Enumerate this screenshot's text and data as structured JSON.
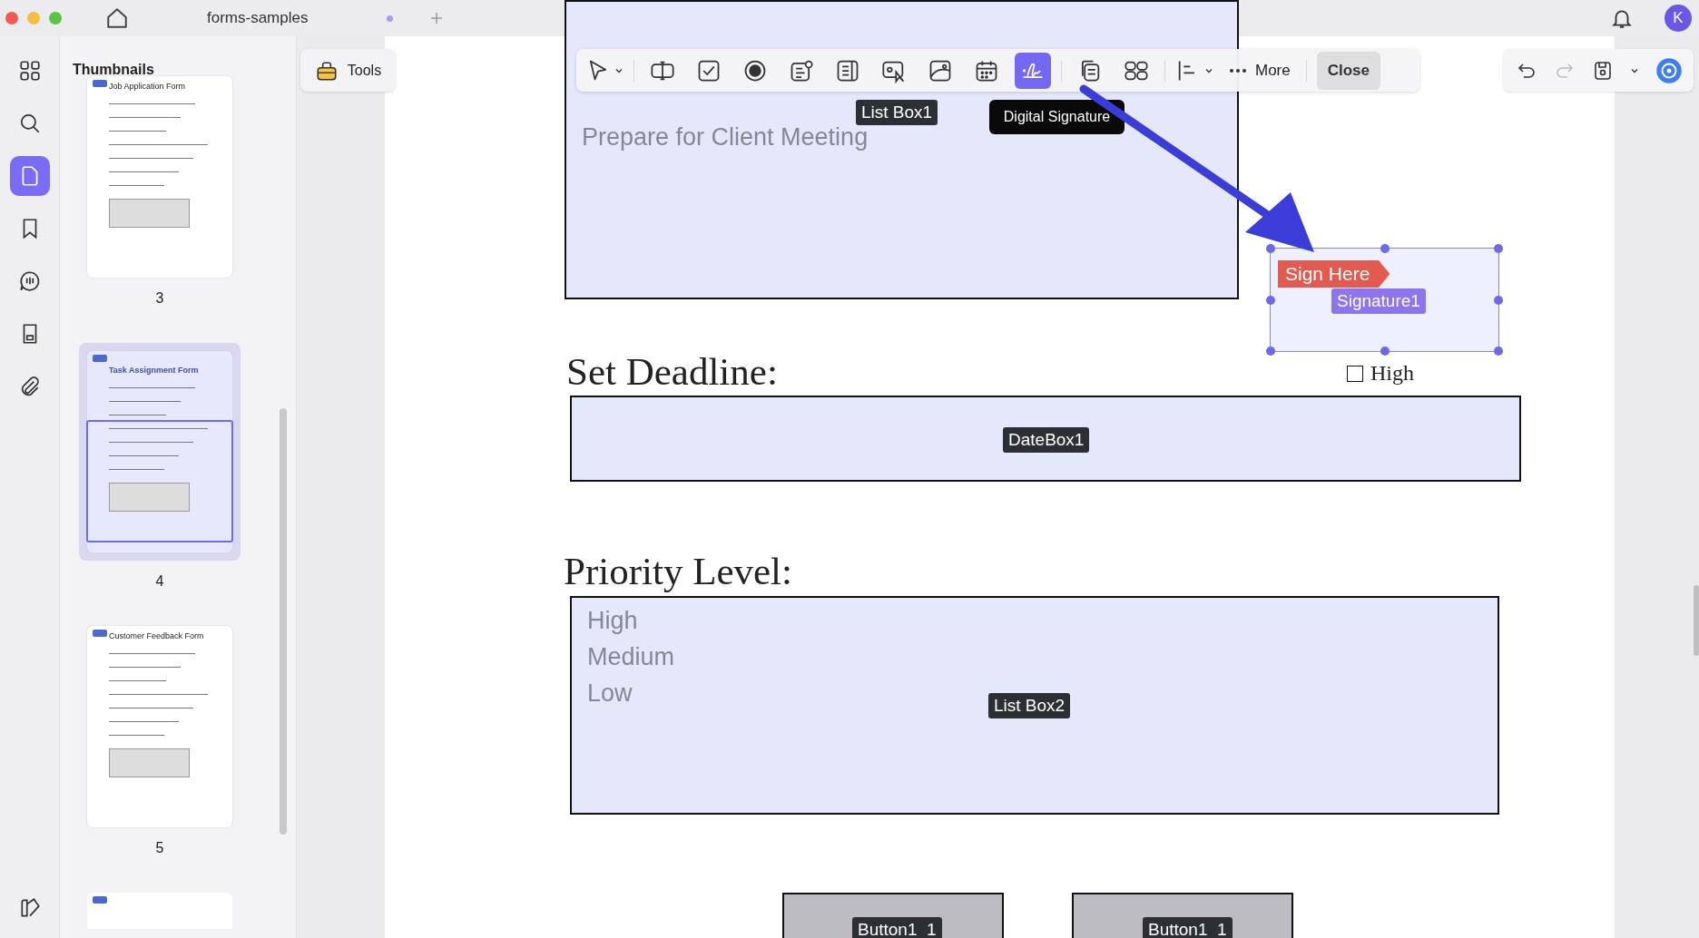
{
  "titlebar": {
    "tab_title": "forms-samples",
    "avatar": "K"
  },
  "rail": [
    {
      "kind": "grid",
      "selected": false
    },
    {
      "kind": "search",
      "selected": false
    },
    {
      "kind": "page",
      "selected": true
    },
    {
      "kind": "bookmark",
      "selected": false
    },
    {
      "kind": "comment",
      "selected": false
    },
    {
      "kind": "file",
      "selected": false
    },
    {
      "kind": "attach",
      "selected": false
    }
  ],
  "thumbnails": {
    "title": "Thumbnails",
    "pages": [
      {
        "title": "Job Application Form",
        "number": "3",
        "selected": false
      },
      {
        "title": "Task Assignment Form",
        "number": "4",
        "selected": true
      },
      {
        "title": "Customer Feedback Form",
        "number": "5",
        "selected": false
      }
    ]
  },
  "tools_button": "Tools",
  "toolbar": {
    "tools": [
      {
        "kind": "pointer",
        "selected": false
      },
      {
        "kind": "textfield",
        "selected": false
      },
      {
        "kind": "checkbox",
        "selected": false
      },
      {
        "kind": "radio",
        "selected": false
      },
      {
        "kind": "combo",
        "selected": false
      },
      {
        "kind": "list",
        "selected": false
      },
      {
        "kind": "button",
        "selected": false
      },
      {
        "kind": "image",
        "selected": false
      },
      {
        "kind": "date",
        "selected": false
      },
      {
        "kind": "signature",
        "selected": true
      },
      {
        "kind": "copy",
        "selected": false
      },
      {
        "kind": "tiles",
        "selected": false
      },
      {
        "kind": "align",
        "selected": false
      }
    ],
    "more": "More",
    "close": "Close"
  },
  "tooltip": "Digital Signature",
  "page": {
    "list_box_1": {
      "items": [
        "Prepare for Client Meeting"
      ],
      "label": "List Box1"
    },
    "signature": {
      "tag": "Sign Here",
      "label": "Signature1"
    },
    "high_checkbox": {
      "label": "High",
      "checked": false
    },
    "deadline_heading": "Set Deadline:",
    "date_box": {
      "label": "DateBox1"
    },
    "priority_heading": "Priority Level:",
    "list_box_2": {
      "items": [
        "High",
        "Medium",
        "Low"
      ],
      "label": "List Box2"
    },
    "buttons": [
      {
        "label": "Button1_1"
      },
      {
        "label": "Button1_1"
      }
    ]
  }
}
